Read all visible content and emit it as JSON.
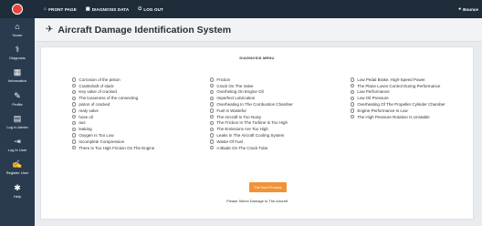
{
  "topbar": {
    "nav": [
      {
        "icon": "home-icon",
        "glyph": "⌂",
        "label": "FRONT PAGE"
      },
      {
        "icon": "grid-icon",
        "glyph": "▦",
        "label": "DIAGNOSIS DATA"
      },
      {
        "icon": "power-icon",
        "glyph": "⏻",
        "label": "LOG OUT"
      }
    ],
    "user_label": "Bounce"
  },
  "sidebar": {
    "items": [
      {
        "icon": "home-icon",
        "glyph": "⌂",
        "label": "Home"
      },
      {
        "icon": "stethoscope-icon",
        "glyph": "⚕",
        "label": "Diagnosis"
      },
      {
        "icon": "grid-icon",
        "glyph": "▦",
        "label": "Information"
      },
      {
        "icon": "edit-icon",
        "glyph": "✎",
        "label": "Profile"
      },
      {
        "icon": "table-icon",
        "glyph": "▤",
        "label": "Log In Admin"
      },
      {
        "icon": "login-icon",
        "glyph": "⇥",
        "label": "Log In User"
      },
      {
        "icon": "register-icon",
        "glyph": "✍",
        "label": "Register User"
      },
      {
        "icon": "help-icon",
        "glyph": "✱",
        "label": "Help"
      }
    ]
  },
  "header": {
    "title": "Aircraft Damage Identification System"
  },
  "menu": {
    "title": "DIAGNOSIS MENU",
    "columns": [
      [
        "Corrosion of the piston",
        "Crankshaft of slack",
        "Key valve of cracked",
        "The looseness of the connecting",
        "piston of cracked",
        "realy valve",
        "hose oil",
        "aus",
        "leaking",
        "Oxygen Is Too Low",
        "Incomplete Compression",
        "There Is Too High Friction On The Engine"
      ],
      [
        "Friction",
        "Crack On The Valve",
        "Overheting On Engine Oil",
        "Imperfect Lubrication",
        "Overheating In The Combustion Chamber",
        "Fuel Is Wasteful",
        "The Aircraft Is Too Noisy",
        "The Friction In The Turbine Is Too High",
        "The Emissions Are Too High",
        "Leaks In The Aircraft Cooling System",
        "Waste Of Fuel",
        "A Blade On The Crack Tube"
      ],
      [
        "Low Pedal Brake, High-Speed Power",
        "The Plane Loses Control During Performance",
        "Low Performance",
        "Low Oil Pressure",
        "Overheating Of The Propeller Cylinder Chamber",
        "Engine Performance Is Low",
        "The High Pressure Rotation Is Unstable"
      ]
    ],
    "submit_label": "The Next Process",
    "hint": "Please Select Damage to The Aircraft"
  },
  "colors": {
    "topbar": "#1f2d3a",
    "sidebar": "#2a3b4f",
    "accent": "#f0933a",
    "logo": "#e8423c"
  }
}
